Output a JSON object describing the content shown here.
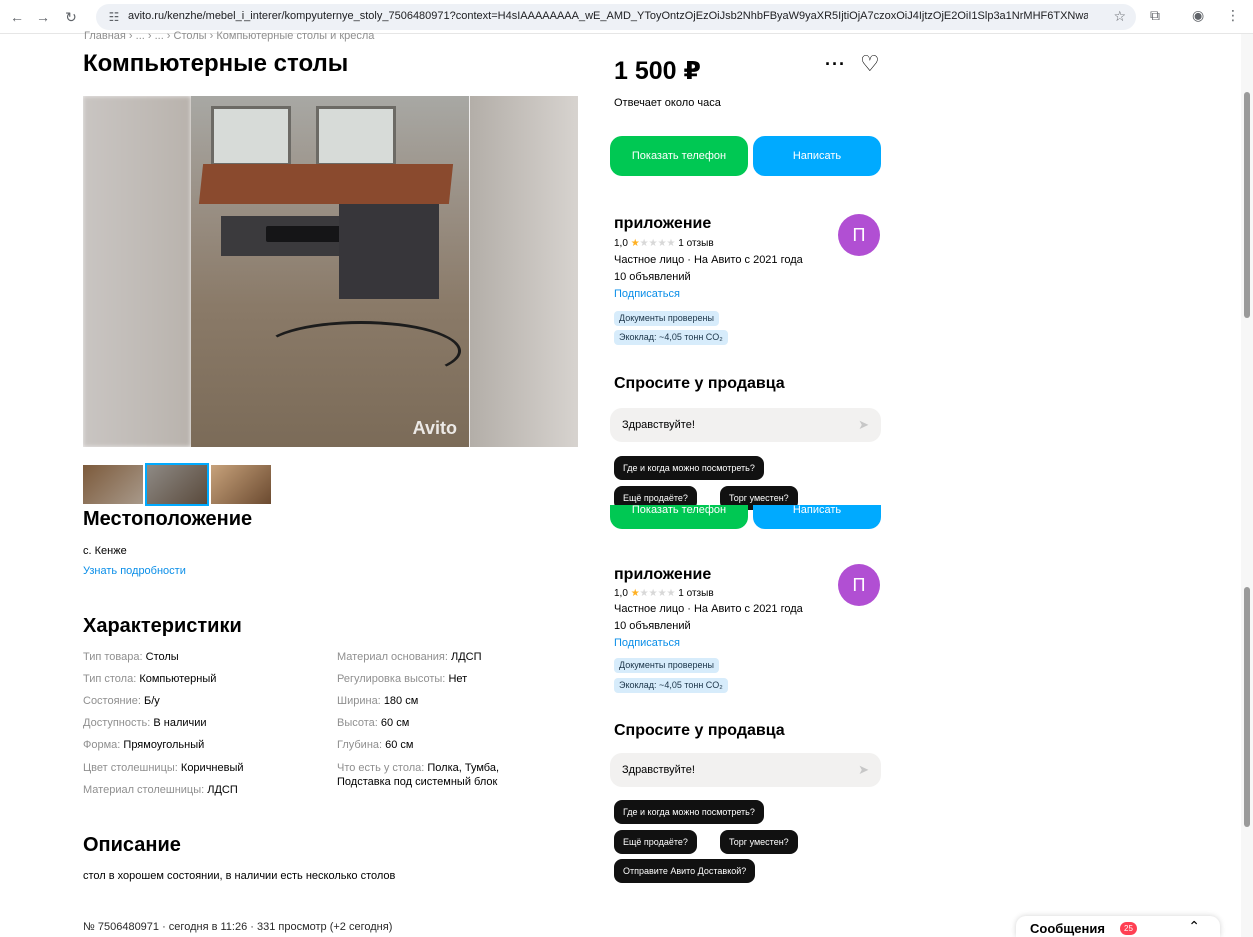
{
  "browser": {
    "url": "avito.ru/kenzhe/mebel_i_interer/kompyuternye_stoly_7506480971?context=H4sIAAAAAAAA_wE_AMD_YToyOntzOjEzOiJsb2NhbFByaW9yaXR5IjtiOjA7czoxOiJ4IjtzOjE2OiI1Slp3a1NrMHF6TXNwa...",
    "icons": [
      "back-arrow-icon",
      "forward-arrow-icon",
      "reload-icon",
      "site-settings-icon",
      "bookmark-star-icon",
      "extensions-icon",
      "profile-icon",
      "kebab-menu-icon"
    ]
  },
  "breadcrumb": "Главная › ... › ... › Столы › Компьютерные столы и кресла",
  "title": "Компьютерные столы",
  "gallery": {
    "watermark": "Avito",
    "thumb_count": 3
  },
  "location": {
    "heading": "Местоположение",
    "address": "с. Кенже",
    "details_link": "Узнать подробности"
  },
  "specs": {
    "heading": "Характеристики",
    "left": [
      {
        "key": "Тип товара:",
        "value": "Столы"
      },
      {
        "key": "Тип стола:",
        "value": "Компьютерный"
      },
      {
        "key": "Состояние:",
        "value": "Б/у"
      },
      {
        "key": "Доступность:",
        "value": "В наличии"
      },
      {
        "key": "Форма:",
        "value": "Прямоугольный"
      },
      {
        "key": "Цвет столешницы:",
        "value": "Коричневый"
      },
      {
        "key": "Материал столешницы:",
        "value": "ЛДСП"
      }
    ],
    "right": [
      {
        "key": "Материал основания:",
        "value": "ЛДСП"
      },
      {
        "key": "Регулировка высоты:",
        "value": "Нет"
      },
      {
        "key": "Ширина:",
        "value": "180 см"
      },
      {
        "key": "Высота:",
        "value": "60 см"
      },
      {
        "key": "Глубина:",
        "value": "60 см"
      },
      {
        "key": "Что есть у стола:",
        "value": "Полка, Тумба,",
        "value2": "Подставка под системный блок"
      }
    ]
  },
  "description": {
    "heading": "Описание",
    "text": "стол в хорошем состоянии, в наличии есть несколько столов"
  },
  "meta": "№ 7506480971 · сегодня в 11:26 · 331 просмотр (+2 сегодня)",
  "sidebar": {
    "price": "1 500 ₽",
    "more": "···",
    "favorite": "♡",
    "responds": "Отвечает около часа",
    "show_phone": "Показать телефон",
    "write": "Написать",
    "seller": {
      "name": "приложение",
      "rating": "1,0",
      "reviews": "1 отзыв",
      "type": "Частное лицо · На Авито с 2021 года",
      "ads": "10 объявлений",
      "subscribe": "Подписаться",
      "badge_docs": "Документы проверены",
      "badge_eco": "Экоклад: ~4,05 тонн CO₂",
      "avatar_letter": "П",
      "avatar_color": "#b14fd3"
    },
    "ask": {
      "heading": "Спросите у продавца",
      "input": "Здравствуйте!",
      "chip_where": "Где и когда можно посмотреть?",
      "chip_selling": "Ещё продаёте?",
      "chip_bargain": "Торг уместен?",
      "chip_delivery": "Отправите Авито Доставкой?"
    }
  },
  "messages": {
    "label": "Сообщения",
    "count": "25"
  },
  "colors": {
    "green": "#00c853",
    "blue": "#00aaff",
    "link": "#0a8ee8"
  }
}
